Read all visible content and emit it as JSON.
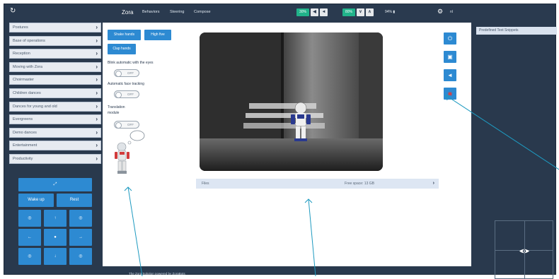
{
  "topbar": {
    "brand": "Zora",
    "menu": [
      "Behaviors",
      "Steering",
      "Compose"
    ],
    "volume_pct": "30%",
    "brightness_pct": "80%",
    "battery": "94%",
    "lang": "nl"
  },
  "leftmenu": {
    "items": [
      "Postures",
      "Base of operations",
      "Reception",
      "Moving with Zora",
      "Choirmaster",
      "Children dances",
      "Dances for young and old",
      "Evergreens",
      "Demo dances",
      "Entertainment",
      "Productivity"
    ]
  },
  "pad": {
    "wake_up": "Wake up",
    "rest": "Rest"
  },
  "main": {
    "buttons": [
      "Shake hands",
      "High five",
      "Clap hands"
    ],
    "blink_label": "Blink automatic with the eyes",
    "face_tracking_label": "Automatic face tracking",
    "translation_label_1": "Translation",
    "translation_label_2": "module",
    "toggle_off": "OFF"
  },
  "files": {
    "label": "Files",
    "free_space": "Free space: 13 GB"
  },
  "rightpanel": {
    "title": "Predefined Text Snippets"
  },
  "footer": {
    "text": "The Zora Solution powered by ZoraBots"
  },
  "icons": {
    "power": "power-icon",
    "camera": "camera-icon",
    "volume": "volume-icon",
    "record": "record-icon",
    "eye": "eye-icon"
  },
  "colors": {
    "app_bg": "#29394d",
    "accent_blue": "#2d8ad2",
    "accent_green": "#21b38a",
    "record_red": "#e23b3b"
  }
}
